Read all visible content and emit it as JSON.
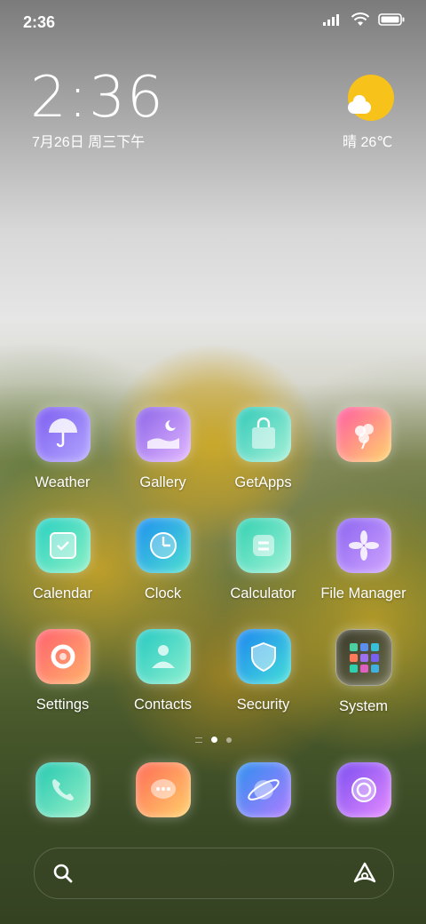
{
  "status_bar": {
    "time": "2:36",
    "icons": [
      "signal-icon",
      "wifi-icon",
      "battery-icon"
    ]
  },
  "clock_widget": {
    "time": "2:36",
    "date": "7月26日 周三下午"
  },
  "weather_widget": {
    "text": "晴 26℃",
    "icon": "sun-cloud-icon"
  },
  "apps": [
    {
      "label": "Weather",
      "icon": "umbrella-icon",
      "colors": [
        "#7c5cf0",
        "#b3a7ff"
      ]
    },
    {
      "label": "Gallery",
      "icon": "moon-landscape-icon",
      "colors": [
        "#8a62e8",
        "#e3b8ff"
      ]
    },
    {
      "label": "GetApps",
      "icon": "shopping-bag-icon",
      "colors": [
        "#2fc9b8",
        "#a6f1d7"
      ]
    },
    {
      "label": "",
      "icon": "flower-icon",
      "colors": [
        "#ff5aa0",
        "#ffd46b"
      ]
    },
    {
      "label": "Calendar",
      "icon": "calendar-check-icon",
      "colors": [
        "#26d0c0",
        "#8df0c6"
      ]
    },
    {
      "label": "Clock",
      "icon": "clock-icon",
      "colors": [
        "#1d8ff0",
        "#4fe0d0"
      ]
    },
    {
      "label": "Calculator",
      "icon": "calculator-icon",
      "colors": [
        "#2fd0b0",
        "#a0f2d6"
      ]
    },
    {
      "label": "File Manager",
      "icon": "flower-folder-icon",
      "colors": [
        "#8a62f0",
        "#d1a6ff"
      ]
    },
    {
      "label": "Settings",
      "icon": "gear-icon",
      "colors": [
        "#ff5f6d",
        "#ffb36b"
      ]
    },
    {
      "label": "Contacts",
      "icon": "person-icon",
      "colors": [
        "#22c8c0",
        "#8ef0d0"
      ]
    },
    {
      "label": "Security",
      "icon": "shield-icon",
      "colors": [
        "#1b85f0",
        "#46e0d8"
      ]
    },
    {
      "label": "System",
      "icon": "folder-icon",
      "colors": [
        "#3a3a2a",
        "#6a6a4a"
      ]
    }
  ],
  "page_indicator": {
    "pages": 2,
    "active": 1
  },
  "dock": [
    {
      "label": "Phone",
      "icon": "phone-icon",
      "colors": [
        "#22c8b0",
        "#9af0c8"
      ]
    },
    {
      "label": "Messages",
      "icon": "message-icon",
      "colors": [
        "#ff6a55",
        "#ffd06b"
      ]
    },
    {
      "label": "Browser",
      "icon": "planet-icon",
      "colors": [
        "#2d8ff0",
        "#b07cff"
      ]
    },
    {
      "label": "Camera",
      "icon": "camera-icon",
      "colors": [
        "#7a4cf0",
        "#e58cff"
      ]
    }
  ],
  "search_bar": {
    "left_icon": "search-icon",
    "right_icon": "assistant-icon"
  }
}
